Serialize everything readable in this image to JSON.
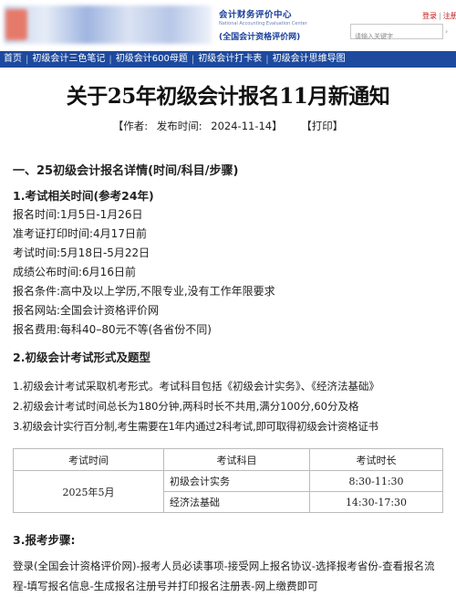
{
  "header": {
    "org_title": "会计财务评价中心",
    "org_en": "National Accounting Evaluation Center",
    "org_sub": "(全国会计资格评价网)",
    "search_placeholder": "请输入关键字",
    "login": "登录",
    "register": "注册"
  },
  "nav": [
    {
      "label": "首页"
    },
    {
      "label": "初级会计三色笔记"
    },
    {
      "label": "初级会计600母题"
    },
    {
      "label": "初级会计打卡表"
    },
    {
      "label": "初级会计思维导图"
    }
  ],
  "article": {
    "title": "关于25年初级会计报名11月新通知",
    "author_label": "【作者:",
    "publish_label": "发布时间:",
    "publish_date": "2024-11-14】",
    "print_label": "【打印】"
  },
  "section1": {
    "heading": "一、25初级会计报名详情(时间/科目/步骤)",
    "sub1": "1.考试相关时间(参考24年)",
    "lines": [
      "报名时间:1月5日-1月26日",
      "准考证打印时间:4月17日前",
      "考试时间:5月18日-5月22日",
      "成绩公布时间:6月16日前",
      "报名条件:高中及以上学历,不限专业,没有工作年限要求",
      "报名网站:全国会计资格评价网",
      "报名费用:每科40–80元不等(各省份不同)"
    ],
    "sub2": "2.初级会计考试形式及题型",
    "exam_lines": [
      "1.初级会计考试采取机考形式。考试科目包括《初级会计实务》、《经济法基础》",
      "2.初级会计考试时间总长为180分钟,两科时长不共用,满分100分,60分及格",
      "3.初级会计实行百分制,考生需要在1年内通过2科考试,即可取得初级会计资格证书"
    ]
  },
  "table": {
    "headers": [
      "考试时间",
      "考试科目",
      "考试时长"
    ],
    "date": "2025年5月",
    "rows": [
      {
        "subject": "初级会计实务",
        "duration": "8:30-11:30"
      },
      {
        "subject": "经济法基础",
        "duration": "14:30-17:30"
      }
    ]
  },
  "section3": {
    "heading": "3.报考步骤:",
    "steps": "登录(全国会计资格评价网)-报考人员必读事项-接受网上报名协议-选择报考省份-查看报名流程-填写报名信息-生成报名注册号并打印报名注册表-网上缴费即可"
  }
}
